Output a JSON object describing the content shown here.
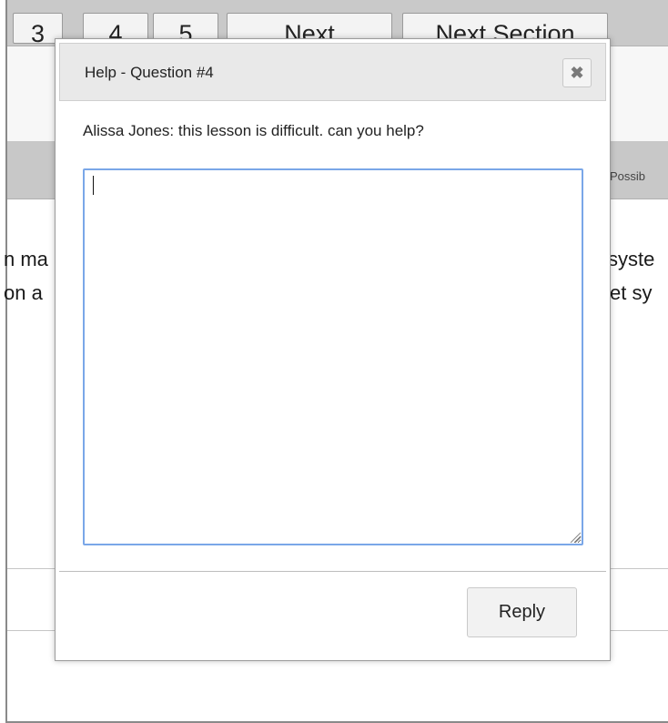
{
  "pagination": {
    "buttons": [
      "3",
      "4",
      "5",
      "Next",
      "Next Section"
    ]
  },
  "background": {
    "points_header": "Possib",
    "line_left_1": "n ma",
    "line_left_2": "on a",
    "line_right_1": "syste",
    "line_right_2": "et sy"
  },
  "dialog": {
    "title": "Help - Question #4",
    "close_label": "✖",
    "message": "Alissa Jones: this lesson is difficult. can you help?",
    "reply_text": "",
    "reply_button": "Reply"
  },
  "colors": {
    "textarea_focus_border": "#7aa7e8",
    "header_bar": "#c9c9c9",
    "dialog_header": "#e9e9e9"
  }
}
